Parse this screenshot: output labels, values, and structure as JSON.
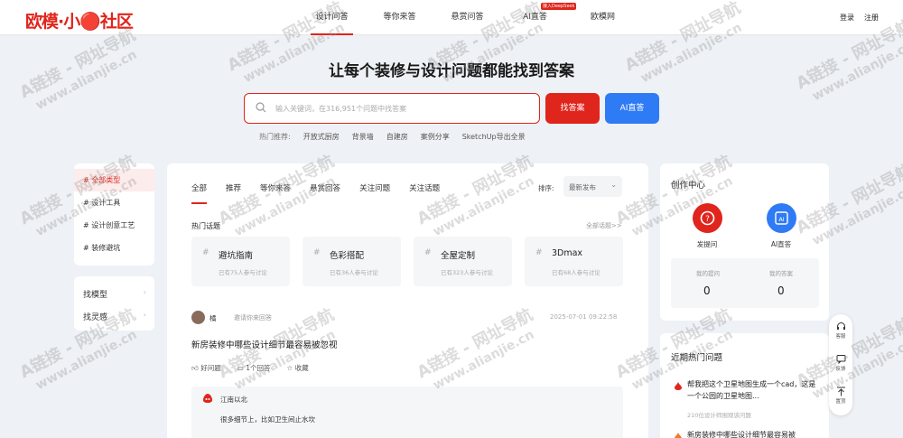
{
  "header": {
    "logo": "欧模·小🔴社区",
    "nav": [
      {
        "label": "设计问答",
        "active": true
      },
      {
        "label": "等你来答"
      },
      {
        "label": "悬赏问答"
      },
      {
        "label": "AI直答",
        "badge": "接入DeepSeek"
      },
      {
        "label": "欧模网"
      }
    ],
    "login": "登录",
    "register": "注册"
  },
  "hero": {
    "title": "让每个装修与设计问题都能找到答案",
    "search_placeholder": "输入关键词，在316,951个问题中找答案",
    "find_button": "找答案",
    "ai_button": "AI直答",
    "hot_label": "热门推荐:",
    "hot_tags": [
      "开放式厨房",
      "背景墙",
      "自建房",
      "案例分享",
      "SketchUp导出全景"
    ]
  },
  "sidebar": {
    "categories": [
      "# 全部类型",
      "# 设计工具",
      "# 设计创意工艺",
      "# 装修避坑"
    ],
    "links": [
      "找模型",
      "找灵感"
    ]
  },
  "main": {
    "tabs": [
      "全部",
      "推荐",
      "等你来答",
      "悬赏回答",
      "关注问题",
      "关注话题"
    ],
    "sort_label": "排序:",
    "sort_value": "最新发布",
    "topics_title": "热门话题",
    "all_topics": "全部话题>>",
    "topics": [
      {
        "name": "避坑指南",
        "count": "已有75人参与讨论"
      },
      {
        "name": "色彩搭配",
        "count": "已有36人参与讨论"
      },
      {
        "name": "全屋定制",
        "count": "已有323人参与讨论"
      },
      {
        "name": "3Dmax",
        "count": "已有68人参与讨论"
      }
    ],
    "post": {
      "user": "橘",
      "invite": "邀请你来回答",
      "time": "2025-07-01 09:22:58",
      "title": "新房装修中哪些设计细节最容易被忽视",
      "actions": [
        "好问题",
        "1个回答",
        "收藏"
      ],
      "answer_user": "江南以北",
      "answer_text": "很多细节上，比如卫生间止水坎"
    }
  },
  "creation": {
    "title": "创作中心",
    "ask_label": "发提问",
    "ai_label": "AI直答",
    "stat1_label": "我的提问",
    "stat1_value": "0",
    "stat2_label": "我的答案",
    "stat2_value": "0"
  },
  "recent": {
    "title": "近期热门问题",
    "items": [
      {
        "text": "帮我把这个卫星地图生成一个cad，这是一个公园的卫星地图...",
        "meta": "210位设计师围观该问题"
      },
      {
        "text": "新房装修中哪些设计细节最容易被",
        "meta": ""
      }
    ]
  },
  "float_bar": [
    "客服",
    "反馈",
    "置顶"
  ],
  "watermark": {
    "line1": "A链接 - 网址导航",
    "line2": "www.alianjie.cn"
  },
  "colors": {
    "accent": "#e0251c",
    "blue": "#2f7bf5"
  }
}
